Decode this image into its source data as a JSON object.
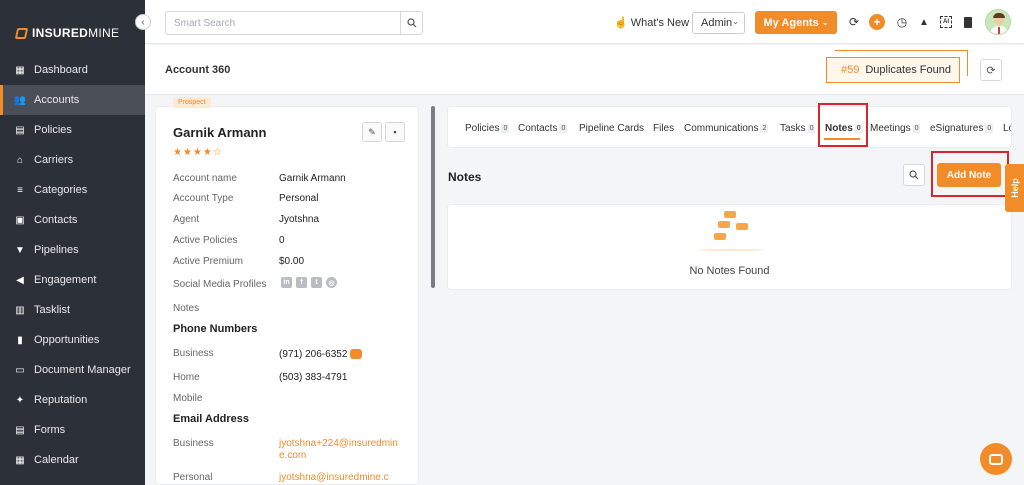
{
  "brand": {
    "bold": "INSURED",
    "light": "MINE"
  },
  "sidebar": {
    "collapse_icon": "chevron-left-icon",
    "items": [
      {
        "label": "Dashboard",
        "icon": "dashboard-icon",
        "active": false
      },
      {
        "label": "Accounts",
        "icon": "accounts-icon",
        "active": true
      },
      {
        "label": "Policies",
        "icon": "policies-icon",
        "active": false
      },
      {
        "label": "Carriers",
        "icon": "carriers-icon",
        "active": false
      },
      {
        "label": "Categories",
        "icon": "categories-icon",
        "active": false
      },
      {
        "label": "Contacts",
        "icon": "contacts-icon",
        "active": false
      },
      {
        "label": "Pipelines",
        "icon": "pipelines-icon",
        "active": false
      },
      {
        "label": "Engagement",
        "icon": "engagement-icon",
        "active": false
      },
      {
        "label": "Tasklist",
        "icon": "tasklist-icon",
        "active": false
      },
      {
        "label": "Opportunities",
        "icon": "opportunities-icon",
        "active": false
      },
      {
        "label": "Document Manager",
        "icon": "folder-icon",
        "active": false
      },
      {
        "label": "Reputation",
        "icon": "reputation-icon",
        "active": false
      },
      {
        "label": "Forms",
        "icon": "forms-icon",
        "active": false
      },
      {
        "label": "Calendar",
        "icon": "calendar-icon",
        "active": false
      }
    ]
  },
  "topbar": {
    "search_placeholder": "Smart Search",
    "whats_new": "What's New",
    "role_select": "Admin",
    "my_agents": "My Agents"
  },
  "subheader": {
    "title": "Account 360",
    "duplicates_count": "#59",
    "duplicates_label": "Duplicates Found"
  },
  "account": {
    "badge": "Prospect",
    "name": "Garnik Armann",
    "stars": "★★★★☆",
    "fields": [
      {
        "label": "Account name",
        "value": "Garnik Armann"
      },
      {
        "label": "Account Type",
        "value": "Personal"
      },
      {
        "label": "Agent",
        "value": "Jyotshna"
      },
      {
        "label": "Active Policies",
        "value": "0"
      },
      {
        "label": "Active Premium",
        "value": "$0.00"
      }
    ],
    "social_label": "Social Media Profiles",
    "notes_label": "Notes",
    "phone_section": "Phone Numbers",
    "phones": [
      {
        "label": "Business",
        "value": "(971) 206-6352"
      },
      {
        "label": "Home",
        "value": "(503) 383-4791"
      },
      {
        "label": "Mobile",
        "value": ""
      }
    ],
    "email_section": "Email Address",
    "emails": [
      {
        "label": "Business",
        "value": "jyotshna+224@insuredmine.com"
      },
      {
        "label": "Personal",
        "value": "jyotshna@insuredmine.c"
      }
    ]
  },
  "tabs": [
    {
      "label": "Policies",
      "count": "0"
    },
    {
      "label": "Contacts",
      "count": "0"
    },
    {
      "label": "Pipeline Cards",
      "count": ""
    },
    {
      "label": "Files",
      "count": ""
    },
    {
      "label": "Communications",
      "count": "2"
    },
    {
      "label": "Tasks",
      "count": "0"
    },
    {
      "label": "Notes",
      "count": "0"
    },
    {
      "label": "Meetings",
      "count": "0"
    },
    {
      "label": "eSignatures",
      "count": "0"
    },
    {
      "label": "Lo",
      "count": ""
    }
  ],
  "notes": {
    "title": "Notes",
    "add_button": "Add Note",
    "empty_text": "No Notes Found"
  },
  "help": "Help",
  "colors": {
    "accent": "#f28c28",
    "sidebar": "#2c3039",
    "highlight": "#d9262c"
  }
}
